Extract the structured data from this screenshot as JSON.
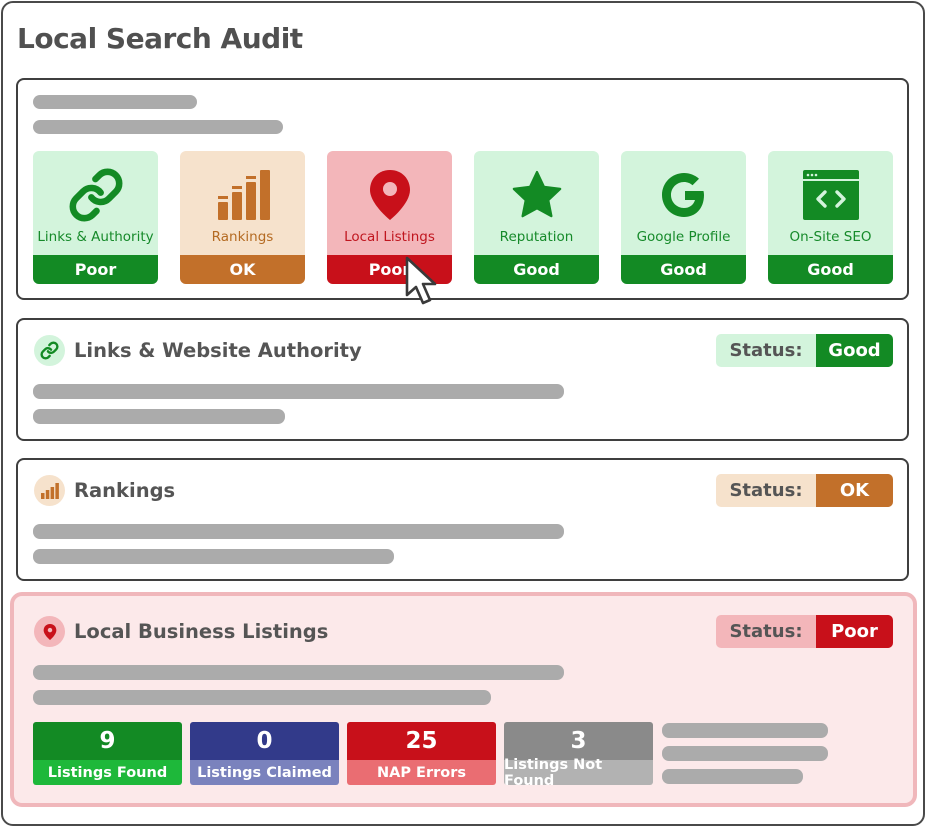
{
  "app": {
    "title": "Local Search Audit"
  },
  "colors": {
    "good": "#138a24",
    "ok": "#c2702a",
    "poor": "#c8101a",
    "good_bg": "#d3f4dc",
    "ok_bg": "#f6e2cc",
    "poor_bg": "#f3b6ba",
    "claimed": "#323a8a",
    "not_found": "#8a8a8a"
  },
  "summary": {
    "tiles": [
      {
        "label": "Links & Authority",
        "status": "Poor",
        "icon": "link-icon",
        "tone": "green"
      },
      {
        "label": "Rankings",
        "status": "OK",
        "icon": "bar-chart-icon",
        "tone": "orange"
      },
      {
        "label": "Local Listings",
        "status": "Poor",
        "icon": "map-pin-icon",
        "tone": "red"
      },
      {
        "label": "Reputation",
        "status": "Good",
        "icon": "star-icon",
        "tone": "green"
      },
      {
        "label": "Google Profile",
        "status": "Good",
        "icon": "google-g-icon",
        "tone": "green"
      },
      {
        "label": "On-Site SEO",
        "status": "Good",
        "icon": "code-window-icon",
        "tone": "green"
      }
    ]
  },
  "sections": [
    {
      "title": "Links & Website Authority",
      "status_key": "Status:",
      "status_value": "Good",
      "icon": "link-icon"
    },
    {
      "title": "Rankings",
      "status_key": "Status:",
      "status_value": "OK",
      "icon": "bar-chart-icon"
    },
    {
      "title": "Local Business Listings",
      "status_key": "Status:",
      "status_value": "Poor",
      "icon": "map-pin-icon"
    }
  ],
  "listings_stats": [
    {
      "value": "9",
      "label": "Listings Found"
    },
    {
      "value": "0",
      "label": "Listings Claimed"
    },
    {
      "value": "25",
      "label": "NAP Errors"
    },
    {
      "value": "3",
      "label": "Listings Not Found"
    }
  ],
  "cursor": {
    "icon": "mouse-pointer-icon"
  }
}
